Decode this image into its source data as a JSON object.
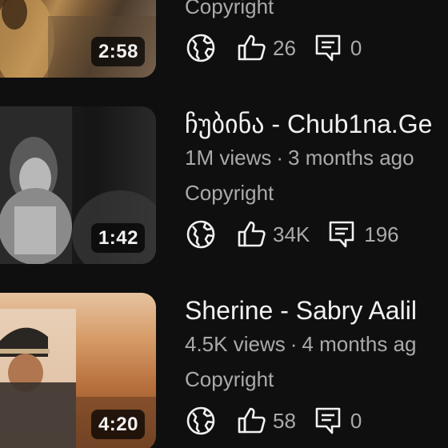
{
  "videos": [
    {
      "title": "",
      "views": "",
      "age": "",
      "license": "Copyright",
      "duration": "2:58",
      "likes": "26",
      "comments": "0",
      "thumb_colors": [
        "#8a6a3e",
        "#3b2c1c",
        "#c8a06a"
      ]
    },
    {
      "title": "ჩუბინა - Chub1na.Ge",
      "views": "1M views",
      "age": "3 months ago",
      "license": "Copyright",
      "duration": "1:42",
      "likes": "34K",
      "comments": "196",
      "thumb_colors": [
        "#1c1c1c",
        "#9a9a9a",
        "#3a3a3a"
      ]
    },
    {
      "title": "Sherine - Sabry Aalil",
      "views": "4.5K views",
      "age": "4 months ag",
      "license": "Copyright",
      "duration": "4:20",
      "likes": "58",
      "comments": "0",
      "thumb_colors": [
        "#c98a55",
        "#2a2420",
        "#e2b58a"
      ]
    }
  ],
  "meta_separator": "·",
  "icons": {
    "globe": "globe-icon",
    "like": "thumbs-up-icon",
    "comment": "comment-icon"
  },
  "colors": {
    "background": "#0f0f0f",
    "primary_text": "#f1f1f1",
    "secondary_text": "#aaaaaa"
  }
}
